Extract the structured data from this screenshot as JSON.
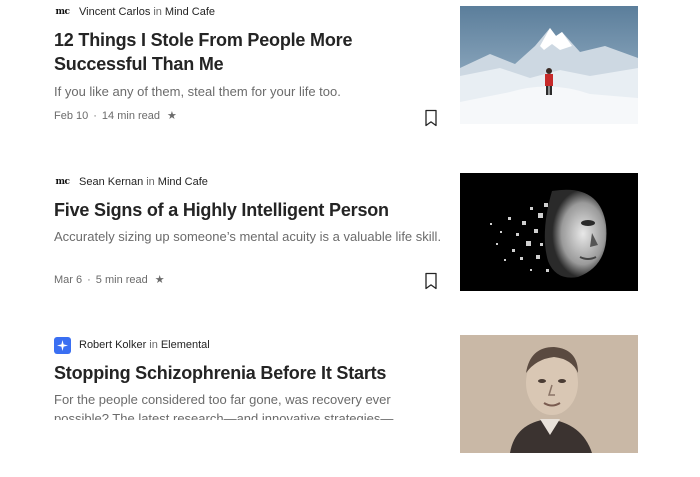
{
  "articles": [
    {
      "author": "Vincent Carlos",
      "in_text": "in",
      "publication": "Mind Cafe",
      "publication_logo": "mc",
      "title": "12 Things I Stole From People More Successful Than Me",
      "description": "If you like any of them, steal them for your life too.",
      "date": "Feb 10",
      "separator": "·",
      "read_time": "14 min read",
      "star": "★",
      "thumbnail": "mountain-climber-image"
    },
    {
      "author": "Sean Kernan",
      "in_text": "in",
      "publication": "Mind Cafe",
      "publication_logo": "mc",
      "title": "Five Signs of a Highly Intelligent Person",
      "description": "Accurately sizing up someone’s mental acuity is a valuable life skill.",
      "date": "Mar 6",
      "separator": "·",
      "read_time": "5 min read",
      "star": "★",
      "thumbnail": "pixelated-face-image"
    },
    {
      "author": "Robert Kolker",
      "in_text": "in",
      "publication": "Elemental",
      "publication_logo": "elemental-icon",
      "title": "Stopping Schizophrenia Before It Starts",
      "description": "For the people considered too far gone, was recovery ever possible? The latest research—and innovative strategies—…",
      "thumbnail": "vintage-portrait-image"
    }
  ],
  "colors": {
    "text_primary": "#242424",
    "text_secondary": "#6b6b6b",
    "elemental_brand": "#3a6ff2",
    "background": "#ffffff"
  }
}
